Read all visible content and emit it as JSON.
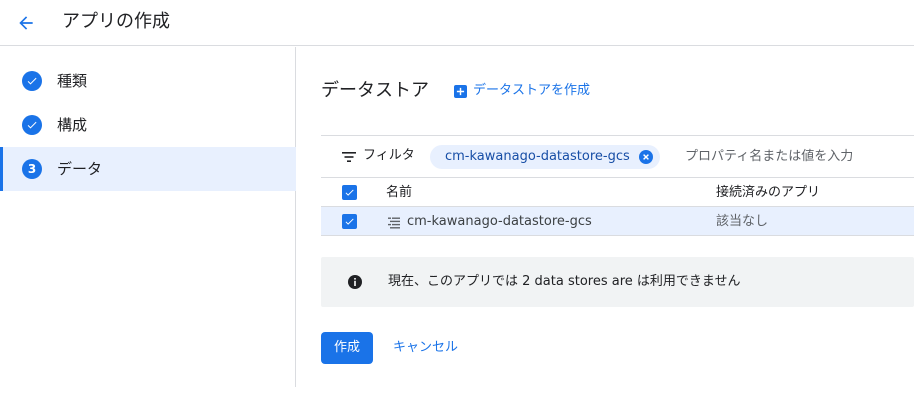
{
  "header": {
    "title": "アプリの作成",
    "back_icon": "arrow-back-icon"
  },
  "sidebar": {
    "steps": [
      {
        "label": "種類",
        "state": "done",
        "icon": "check-circle-icon"
      },
      {
        "label": "構成",
        "state": "done",
        "icon": "check-circle-icon"
      },
      {
        "label": "データ",
        "state": "current",
        "number": "3"
      }
    ]
  },
  "main": {
    "section_title": "データストア",
    "create_datastore_label": "データストアを作成",
    "filter": {
      "label": "フィルタ",
      "chip_value": "cm-kawanago-datastore-gcs",
      "placeholder": "プロパティ名または値を入力"
    },
    "table": {
      "columns": [
        "名前",
        "接続済みのアプリ"
      ],
      "rows": [
        {
          "name": "cm-kawanago-datastore-gcs",
          "connected_apps": "該当なし",
          "checked": true
        }
      ]
    },
    "info_message": "現在、このアプリでは 2 data stores are は利用できません",
    "create_button": "作成",
    "cancel_button": "キャンセル"
  },
  "colors": {
    "accent": "#1a73e8",
    "selected_bg": "#e8f0fe",
    "info_bg": "#f1f3f4",
    "divider": "#dadce0"
  }
}
